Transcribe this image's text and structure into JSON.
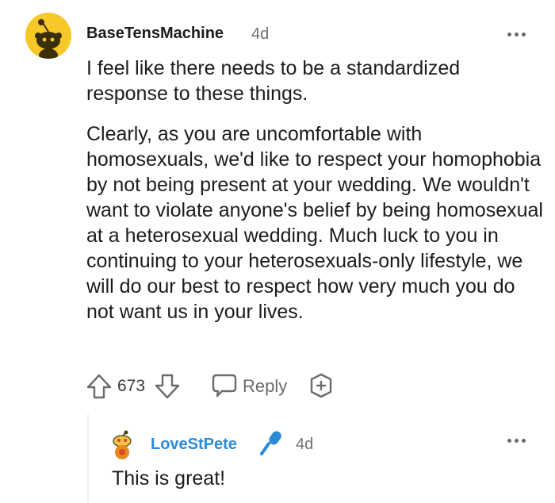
{
  "comment": {
    "author": "BaseTensMachine",
    "time": "4d",
    "avatar_icon": "snoo-avatar-icon",
    "avatar_color": "#f7c928",
    "paragraphs": [
      "I feel like there needs to be a standardized response to these things.",
      "Clearly, as you are uncomfortable with homosexuals, we'd like to respect your homophobia by not being present at your wedding. We wouldn't want to violate anyone's belief by being homosexual at a heterosexual wedding. Much luck to you in continuing to your heterosexuals-only lifestyle, we will do our best to respect how very much you do not want us in your lives."
    ],
    "score": "673",
    "reply_label": "Reply"
  },
  "reply": {
    "author": "LoveStPete",
    "author_color": "#2a8bd8",
    "time": "4d",
    "text": "This is great!"
  }
}
